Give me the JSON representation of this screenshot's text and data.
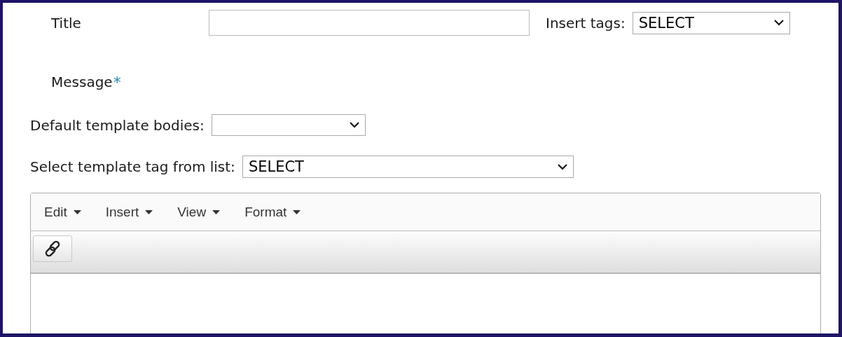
{
  "title_field": {
    "label": "Title"
  },
  "insert_tags": {
    "label": "Insert tags:",
    "value": "SELECT"
  },
  "message": {
    "label": "Message",
    "required_mark": "*"
  },
  "default_template_bodies": {
    "label": "Default template bodies:"
  },
  "template_tag": {
    "label": "Select template tag from list:",
    "value": "SELECT"
  },
  "editor": {
    "menu": [
      "Edit",
      "Insert",
      "View",
      "Format"
    ]
  }
}
